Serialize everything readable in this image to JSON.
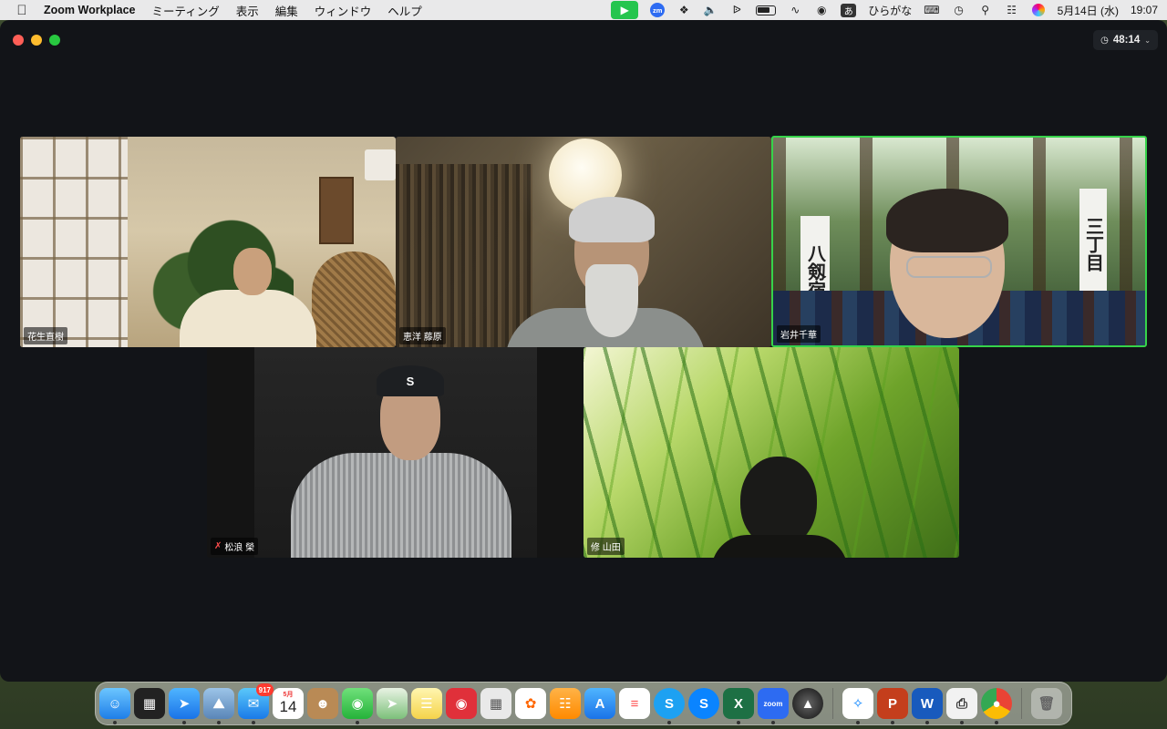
{
  "menubar": {
    "app_name": "Zoom Workplace",
    "menus": [
      "ミーティング",
      "表示",
      "編集",
      "ウィンドウ",
      "ヘルプ"
    ],
    "zm_badge": "zm",
    "ime_char": "あ",
    "ime_label": "ひらがな",
    "date": "5月14日 (水)",
    "time": "19:07"
  },
  "meeting": {
    "timer": "48:14"
  },
  "participants": [
    {
      "name": "花生直樹",
      "muted": false,
      "active_speaker": false
    },
    {
      "name": "恵洋 藤原",
      "muted": false,
      "active_speaker": false
    },
    {
      "name": "岩井千華",
      "muted": false,
      "active_speaker": true
    },
    {
      "name": "松浪 榮",
      "muted": true,
      "active_speaker": false
    },
    {
      "name": "修 山田",
      "muted": false,
      "active_speaker": false
    }
  ],
  "video_text": {
    "banner_left": "八剱宿",
    "banner_right": "三丁目",
    "cap_letter": "S"
  },
  "dock": {
    "mail_badge": "917",
    "calendar_month": "5月",
    "calendar_day": "14",
    "excel_letter": "X",
    "skype_letter": "S",
    "zoom_label": "zoom",
    "word_letter": "W",
    "ppt_letter": "P"
  },
  "colors": {
    "active_speaker_border": "#36d34a",
    "window_bg": "#121418",
    "zoom_video_icon": "#25c54e"
  }
}
